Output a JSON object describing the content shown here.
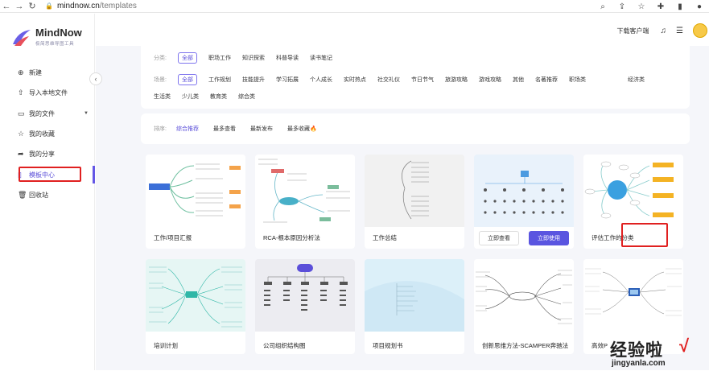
{
  "browser": {
    "url_host": "mindnow.cn",
    "url_path": "/templates"
  },
  "logo": {
    "name": "MindNow",
    "subtitle": "极简思维导图工具"
  },
  "sidebar": {
    "items": [
      {
        "label": "新建",
        "icon": "plus-circle-icon"
      },
      {
        "label": "导入本地文件",
        "icon": "upload-icon"
      },
      {
        "label": "我的文件",
        "icon": "folder-icon"
      },
      {
        "label": "我的收藏",
        "icon": "star-icon"
      },
      {
        "label": "我的分享",
        "icon": "share-icon"
      },
      {
        "label": "模板中心",
        "icon": "book-icon"
      },
      {
        "label": "回收站",
        "icon": "trash-icon"
      }
    ]
  },
  "header": {
    "download_label": "下载客户端"
  },
  "filters": {
    "category_label": "分类:",
    "categories": [
      "全部",
      "职场工作",
      "知识探索",
      "科普导读",
      "读书笔记"
    ],
    "scene_label": "场景:",
    "scenes": [
      "全部",
      "工作规划",
      "技能提升",
      "学习拓展",
      "个人成长",
      "实时热点",
      "社交礼仪",
      "节日节气",
      "旅游攻略",
      "游戏攻略",
      "其他",
      "名著推荐",
      "职场类",
      "经济类",
      "生活类",
      "少儿类",
      "教育类",
      "综合类"
    ]
  },
  "sort": {
    "label": "排序:",
    "options": [
      "综合推荐",
      "最多查看",
      "最新发布",
      "最多收藏🔥"
    ]
  },
  "cards": [
    {
      "title": "工作/项目汇报"
    },
    {
      "title": "RCA-根本原因分析法"
    },
    {
      "title": "工作总结"
    },
    {
      "title": ""
    },
    {
      "title": "评估工作的分类"
    },
    {
      "title": "培训计划"
    },
    {
      "title": "公司组织结构图"
    },
    {
      "title": "项目规划书"
    },
    {
      "title": "创新思维方法-SCAMPER奔驰法"
    },
    {
      "title": "高效P"
    }
  ],
  "hover_card": {
    "view_label": "立即查看",
    "use_label": "立即使用"
  },
  "watermark": {
    "cn": "经验啦",
    "url": "jingyanla.com",
    "check": "√"
  },
  "colors": {
    "accent": "#5b4fd9",
    "highlight_box": "#e02020"
  }
}
